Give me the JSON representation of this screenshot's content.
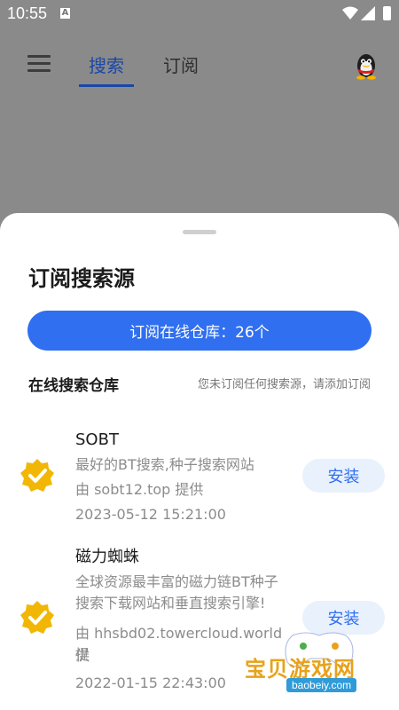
{
  "status": {
    "time": "10:55"
  },
  "appbar": {
    "tabs": [
      {
        "label": "搜索",
        "active": true
      },
      {
        "label": "订阅",
        "active": false
      }
    ]
  },
  "sheet": {
    "title": "订阅搜索源",
    "primary_button": "订阅在线仓库：26个",
    "section_title": "在线搜索仓库",
    "section_hint": "您未订阅任何搜索源，请添加订阅",
    "items": [
      {
        "name": "SOBT",
        "description": "最好的BT搜索,种子搜索网站",
        "provider": "由 sobt12.top 提供",
        "date": "2023-05-12 15:21:00",
        "button": "安装"
      },
      {
        "name": "磁力蜘蛛",
        "description_line1": "全球资源最丰富的磁力链BT种子",
        "description_line2": "搜索下载网站和垂直搜索引擎!",
        "provider_line1": "由 hhsbd02.towercloud.world 提",
        "provider_line2": "供",
        "date": "2022-01-15 22:43:00",
        "button": "安装"
      }
    ]
  },
  "watermark": {
    "text": "宝贝游戏网",
    "url": "baobeiy.com"
  },
  "colors": {
    "accent": "#2f6ff0",
    "badge": "#f2b705",
    "install_bg": "#e9f1fd"
  }
}
